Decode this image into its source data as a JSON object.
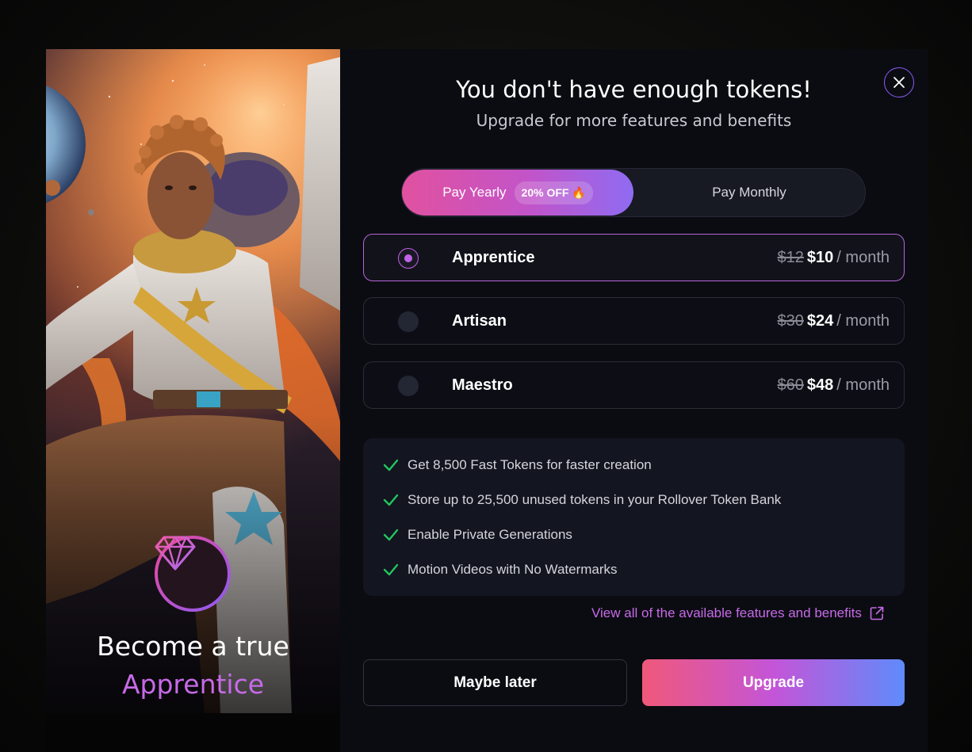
{
  "hero": {
    "line1": "Become a true",
    "line2": "Apprentice"
  },
  "header": {
    "title": "You don't have enough tokens!",
    "subtitle": "Upgrade for more features and benefits"
  },
  "billing_toggle": {
    "yearly_label": "Pay Yearly",
    "yearly_badge": "20% OFF 🔥",
    "monthly_label": "Pay Monthly",
    "selected": "yearly"
  },
  "plans": [
    {
      "name": "Apprentice",
      "old_price": "$12",
      "new_price": "$10",
      "period": "/ month",
      "selected": true
    },
    {
      "name": "Artisan",
      "old_price": "$30",
      "new_price": "$24",
      "period": "/ month",
      "selected": false
    },
    {
      "name": "Maestro",
      "old_price": "$60",
      "new_price": "$48",
      "period": "/ month",
      "selected": false
    }
  ],
  "features": [
    "Get 8,500 Fast Tokens for faster creation",
    "Store up to 25,500 unused tokens in your Rollover Token Bank",
    "Enable Private Generations",
    "Motion Videos with No Watermarks"
  ],
  "view_all_link": "View all of the available features and benefits",
  "buttons": {
    "later": "Maybe later",
    "upgrade": "Upgrade"
  },
  "colors": {
    "accent_purple": "#c76ae8",
    "check_green": "#22c55e",
    "upgrade_gradient": [
      "#f0587a",
      "#c455d8",
      "#5f8bfb"
    ]
  },
  "icons": {
    "close": "close-icon",
    "diamond": "diamond-icon",
    "check": "check-icon",
    "external": "external-link-icon"
  }
}
